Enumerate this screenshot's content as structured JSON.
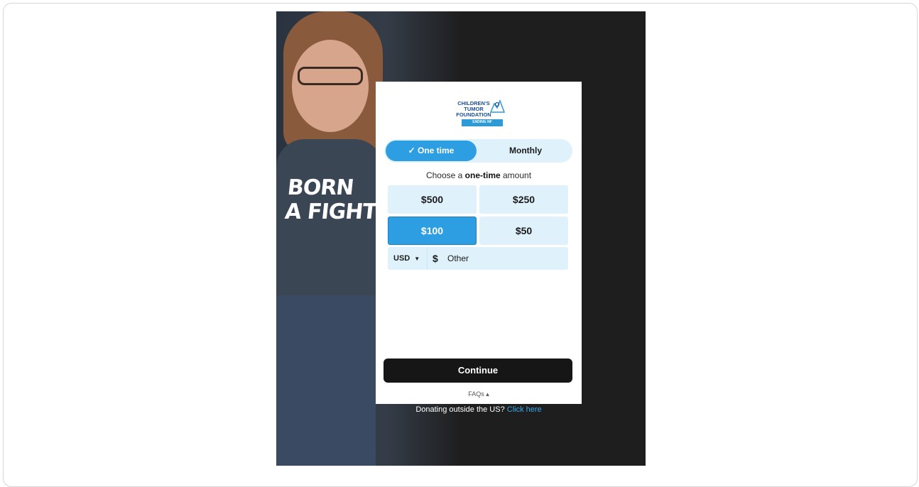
{
  "logo": {
    "lines": [
      "CHILDREN'S",
      "TUMOR",
      "FOUNDATION"
    ],
    "tagline": "ENDING NF",
    "subtag": "THROUGH RESEARCH"
  },
  "photo": {
    "shirt_text_line1": "BORN",
    "shirt_text_line2": "A FIGHTER."
  },
  "frequency": {
    "one_time": "✓ One time",
    "monthly": "Monthly"
  },
  "prompt": {
    "prefix": "Choose a ",
    "bold": "one-time",
    "suffix": " amount"
  },
  "amounts": [
    "$500",
    "$250",
    "$100",
    "$50"
  ],
  "selected_amount": "$100",
  "other": {
    "currency": "USD",
    "symbol": "$",
    "placeholder": "Other"
  },
  "continue_label": "Continue",
  "faqs_label": "FAQs ▴",
  "outside": {
    "text": "Donating outside the US?",
    "link": "Click here"
  },
  "colors": {
    "accent": "#2e9ee2",
    "light_accent": "#dff2fc",
    "button_dark": "#161616",
    "link": "#3aa6e6"
  }
}
